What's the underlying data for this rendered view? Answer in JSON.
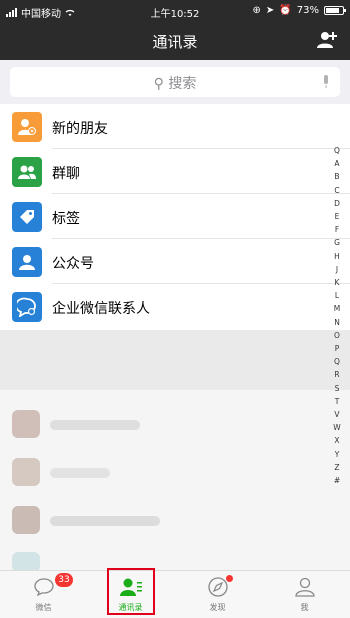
{
  "status_bar": {
    "carrier": "中国移动",
    "time": "上午10:52",
    "battery": "73%"
  },
  "nav": {
    "title": "通讯录",
    "add_icon": "add-contact-icon"
  },
  "search": {
    "placeholder": "搜索"
  },
  "entries": [
    {
      "label": "新的朋友",
      "icon": "new-friend-icon",
      "color": "#f79c38"
    },
    {
      "label": "群聊",
      "icon": "group-chat-icon",
      "color": "#2ba245"
    },
    {
      "label": "标签",
      "icon": "tag-icon",
      "color": "#2782d7"
    },
    {
      "label": "公众号",
      "icon": "official-account-icon",
      "color": "#2782d7"
    },
    {
      "label": "企业微信联系人",
      "icon": "work-contact-icon",
      "color": "#2782d7"
    }
  ],
  "index_letters": [
    "Q",
    "A",
    "B",
    "C",
    "D",
    "E",
    "F",
    "G",
    "H",
    "J",
    "K",
    "L",
    "M",
    "N",
    "O",
    "P",
    "Q",
    "R",
    "S",
    "T",
    "V",
    "W",
    "X",
    "Y",
    "Z",
    "#"
  ],
  "tabbar": {
    "tabs": [
      {
        "label": "微信",
        "icon": "chat-icon",
        "badge": "33"
      },
      {
        "label": "通讯录",
        "icon": "contacts-icon",
        "active": true
      },
      {
        "label": "发现",
        "icon": "compass-icon",
        "dot": true
      },
      {
        "label": "我",
        "icon": "person-icon"
      }
    ],
    "active_color": "#1aad19",
    "badge_color": "#f43530"
  }
}
